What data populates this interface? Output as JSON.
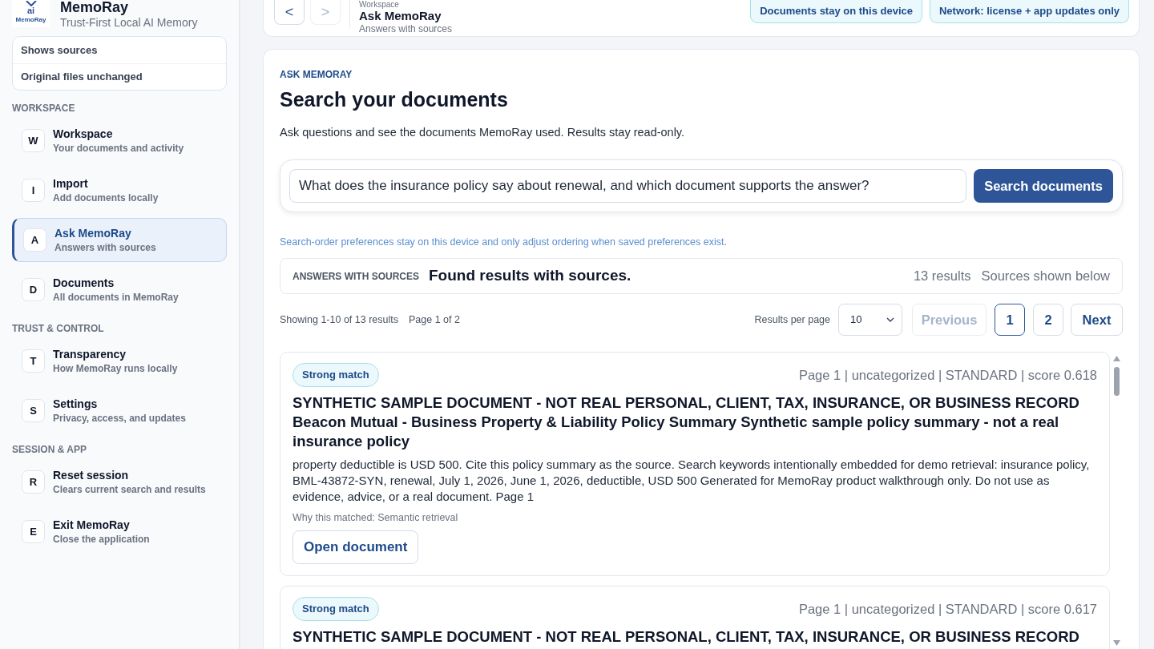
{
  "sidebar": {
    "logo": {
      "mark": "ai",
      "wordmark": "MemoRay"
    },
    "app_name": "MemoRay",
    "tagline": "Trust-First Local AI Memory",
    "trust_points": [
      "Shows sources",
      "Original files unchanged"
    ],
    "sections": [
      {
        "title": "WORKSPACE",
        "items": [
          {
            "key": "W",
            "title": "Workspace",
            "subtitle": "Your documents and activity",
            "selected": false
          },
          {
            "key": "I",
            "title": "Import",
            "subtitle": "Add documents locally",
            "selected": false
          },
          {
            "key": "A",
            "title": "Ask MemoRay",
            "subtitle": "Answers with sources",
            "selected": true
          },
          {
            "key": "D",
            "title": "Documents",
            "subtitle": "All documents in MemoRay",
            "selected": false
          }
        ]
      },
      {
        "title": "TRUST & CONTROL",
        "items": [
          {
            "key": "T",
            "title": "Transparency",
            "subtitle": "How MemoRay runs locally",
            "selected": false
          },
          {
            "key": "S",
            "title": "Settings",
            "subtitle": "Privacy, access, and updates",
            "selected": false
          }
        ]
      },
      {
        "title": "SESSION & APP",
        "items": [
          {
            "key": "R",
            "title": "Reset session",
            "subtitle": "Clears current search and results",
            "selected": false
          },
          {
            "key": "E",
            "title": "Exit MemoRay",
            "subtitle": "Close the application",
            "selected": false
          }
        ]
      }
    ]
  },
  "header": {
    "back_button": {
      "label": "<",
      "disabled": false
    },
    "forward_button": {
      "label": ">",
      "disabled": true
    },
    "breadcrumb": "Workspace",
    "title": "Ask MemoRay",
    "subtitle": "Answers with sources",
    "badges": [
      "Documents stay on this device",
      "Network: license + app updates only"
    ]
  },
  "main": {
    "eyebrow": "ASK MEMORAY",
    "title": "Search your documents",
    "description": "Ask questions and see the documents MemoRay used. Results stay read-only.",
    "search": {
      "value": "What does the insurance policy say about renewal, and which document supports the answer?",
      "button": "Search documents"
    },
    "hint": "Search-order preferences stay on this device and only adjust ordering when saved preferences exist.",
    "summary": {
      "label": "ANSWERS WITH SOURCES",
      "message": "Found results with sources.",
      "count": "13 results",
      "note": "Sources shown below"
    },
    "pagination": {
      "showing": "Showing 1-10 of 13 results",
      "page": "Page 1 of 2",
      "per_page_label": "Results per page",
      "per_page_value": "10",
      "previous": {
        "label": "Previous",
        "disabled": true
      },
      "pages": [
        {
          "label": "1",
          "selected": true
        },
        {
          "label": "2",
          "selected": false
        }
      ],
      "next": {
        "label": "Next",
        "disabled": false
      }
    },
    "results": [
      {
        "badge": "Strong match",
        "meta": "Page 1 | uncategorized | STANDARD | score 0.618",
        "title": "SYNTHETIC SAMPLE DOCUMENT - NOT REAL PERSONAL, CLIENT, TAX, INSURANCE, OR BUSINESS RECORD Beacon Mutual - Business Property & Liability Policy Summary Synthetic sample policy summary - not a real insurance policy",
        "snippet": "property deductible is USD 500. Cite this policy summary as the source. Search keywords intentionally embedded for demo retrieval: insurance policy, BML-43872-SYN, renewal, July 1, 2026, June 1, 2026, deductible, USD 500 Generated for MemoRay product walkthrough only. Do not use as evidence, advice, or a real document. Page 1",
        "reason": "Why this matched: Semantic retrieval",
        "action": "Open document"
      },
      {
        "badge": "Strong match",
        "meta": "Page 1 | uncategorized | STANDARD | score 0.617",
        "title": "SYNTHETIC SAMPLE DOCUMENT - NOT REAL PERSONAL, CLIENT, TAX, INSURANCE, OR BUSINESS RECORD"
      }
    ]
  }
}
